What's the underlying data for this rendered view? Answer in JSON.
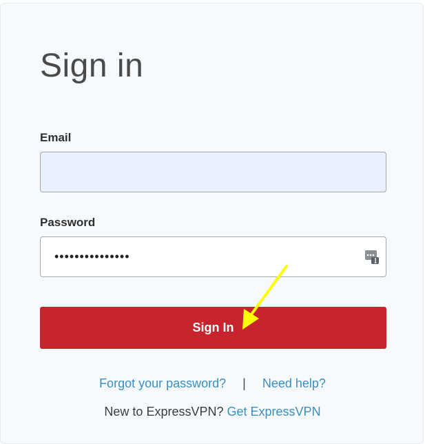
{
  "page": {
    "title": "Sign in"
  },
  "form": {
    "email_label": "Email",
    "email_value": "",
    "password_label": "Password",
    "password_value": "•••••••••••••••",
    "password_manager_icon": "password-manager-key-icon",
    "submit_label": "Sign In"
  },
  "links": {
    "forgot_password": "Forgot your password?",
    "separator": "|",
    "need_help": "Need help?",
    "new_user_text": "New to ExpressVPN?",
    "get_expressvpn": "Get ExpressVPN"
  },
  "colors": {
    "primary_button": "#c8242e",
    "link": "#3a8fc2",
    "email_autofill_bg": "#e8f0fe",
    "annotation_arrow": "#ffff00"
  },
  "annotation": {
    "arrow_icon": "yellow-arrow-pointer-icon"
  }
}
